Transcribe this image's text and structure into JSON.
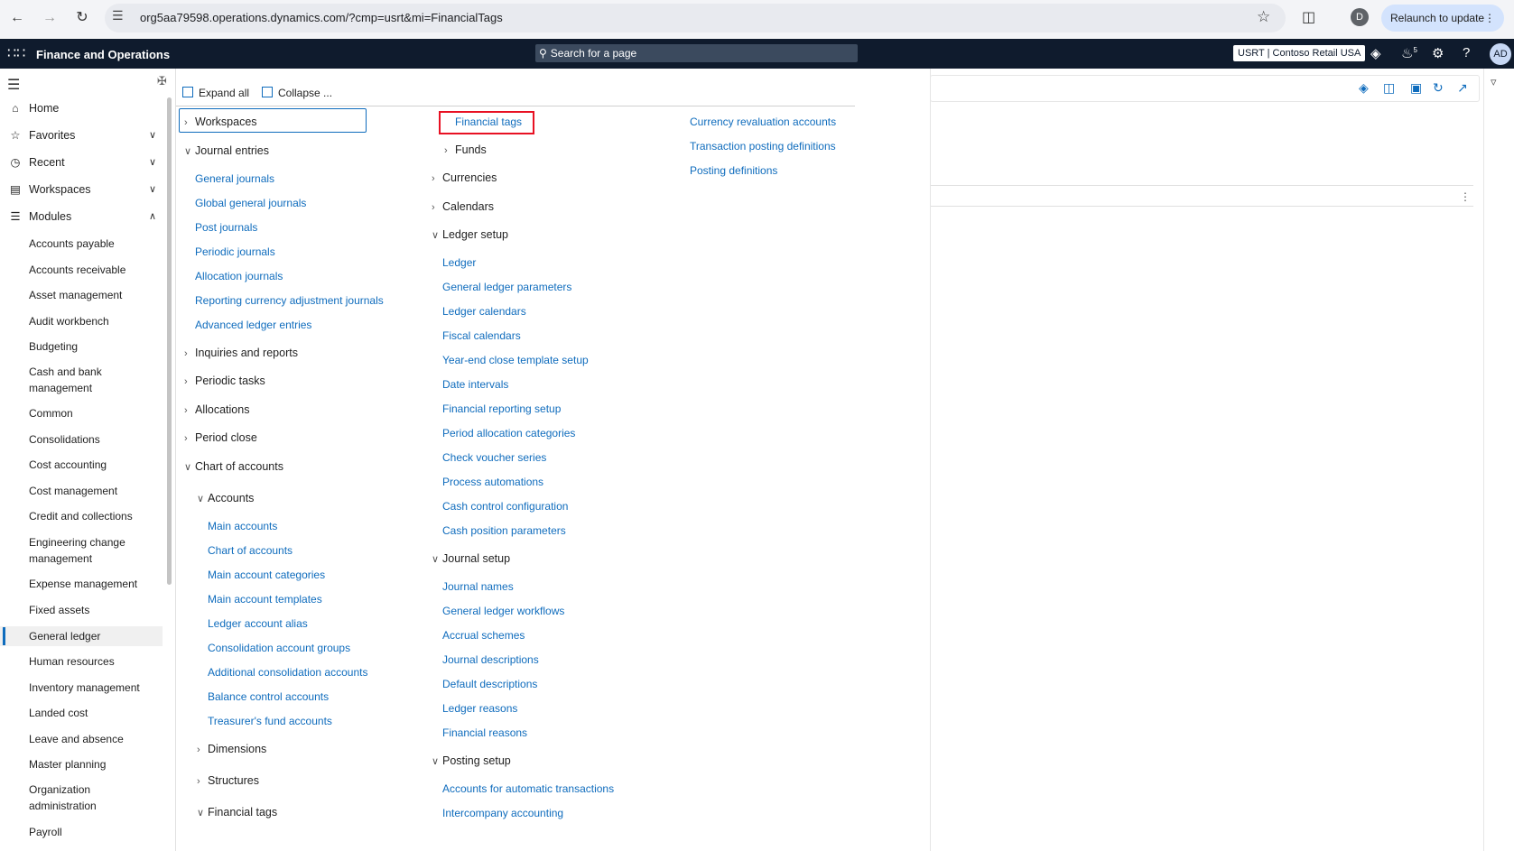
{
  "browser": {
    "url": "org5aa79598.operations.dynamics.com/?cmp=usrt&mi=FinancialTags",
    "profile_initial": "D",
    "relaunch_label": "Relaunch to update"
  },
  "appbar": {
    "title": "Finance and Operations",
    "search_placeholder": "Search for a page",
    "company": "USRT | Contoso Retail USA",
    "avatar": "AD",
    "notification_count": "5"
  },
  "leftnav": {
    "top_items": [
      {
        "label": "Home",
        "icon": "home-icon"
      },
      {
        "label": "Favorites",
        "icon": "star-icon"
      },
      {
        "label": "Recent",
        "icon": "clock-icon"
      },
      {
        "label": "Workspaces",
        "icon": "workspaces-icon"
      },
      {
        "label": "Modules",
        "icon": "list-icon"
      }
    ],
    "modules": [
      "Accounts payable",
      "Accounts receivable",
      "Asset management",
      "Audit workbench",
      "Budgeting",
      "Cash and bank management",
      "Common",
      "Consolidations",
      "Cost accounting",
      "Cost management",
      "Credit and collections",
      "Engineering change management",
      "Expense management",
      "Fixed assets",
      "General ledger",
      "Human resources",
      "Inventory management",
      "Landed cost",
      "Leave and absence",
      "Master planning",
      "Organization administration",
      "Payroll"
    ],
    "selected_module": "General ledger"
  },
  "flyout": {
    "expand_all": "Expand all",
    "collapse": "Collapse ...",
    "col1": {
      "workspaces": "Workspaces",
      "journal_entries": "Journal entries",
      "journal_links": [
        "General journals",
        "Global general journals",
        "Post journals",
        "Periodic journals",
        "Allocation journals",
        "Reporting currency adjustment journals",
        "Advanced ledger entries"
      ],
      "inquiries": "Inquiries and reports",
      "periodic_tasks": "Periodic tasks",
      "allocations": "Allocations",
      "period_close": "Period close",
      "chart_of_accounts": "Chart of accounts",
      "accounts": "Accounts",
      "account_links": [
        "Main accounts",
        "Chart of accounts",
        "Main account categories",
        "Main account templates",
        "Ledger account alias",
        "Consolidation account groups",
        "Additional consolidation accounts",
        "Balance control accounts",
        "Treasurer's fund accounts"
      ],
      "dimensions": "Dimensions",
      "structures": "Structures",
      "financial_tags": "Financial tags"
    },
    "col2": {
      "financial_tags_link": "Financial tags",
      "funds": "Funds",
      "currencies": "Currencies",
      "calendars": "Calendars",
      "ledger_setup": "Ledger setup",
      "ledger_links": [
        "Ledger",
        "General ledger parameters",
        "Ledger calendars",
        "Fiscal calendars",
        "Year-end close template setup",
        "Date intervals",
        "Financial reporting setup",
        "Period allocation categories",
        "Check voucher series",
        "Process automations",
        "Cash control configuration",
        "Cash position parameters"
      ],
      "journal_setup": "Journal setup",
      "journal_setup_links": [
        "Journal names",
        "General ledger workflows",
        "Accrual schemes",
        "Journal descriptions",
        "Default descriptions",
        "Ledger reasons",
        "Financial reasons"
      ],
      "posting_setup": "Posting setup",
      "posting_links": [
        "Accounts for automatic transactions",
        "Intercompany accounting"
      ]
    },
    "col3": {
      "links": [
        "Currency revaluation accounts",
        "Transaction posting definitions",
        "Posting definitions"
      ]
    }
  }
}
